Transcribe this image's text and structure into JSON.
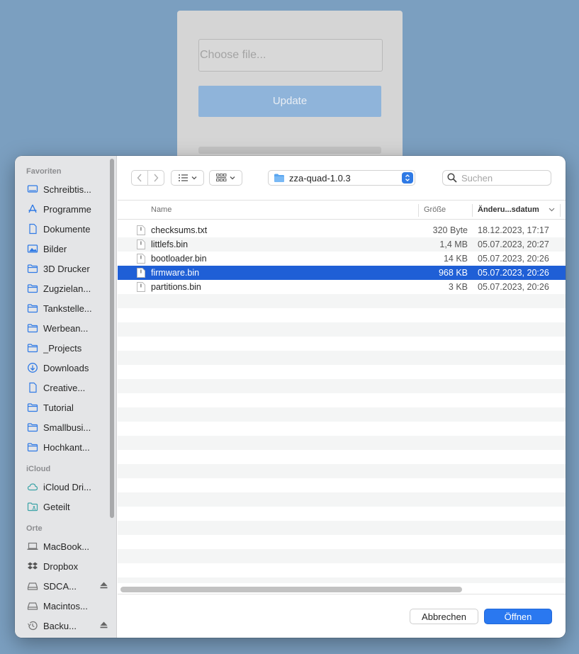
{
  "background_form": {
    "file_placeholder": "Choose file...",
    "update_label": "Update"
  },
  "sidebar": {
    "sections": [
      {
        "title": "Favoriten",
        "items": [
          {
            "label": "Schreibtis...",
            "icon": "desktop-icon"
          },
          {
            "label": "Programme",
            "icon": "applications-icon"
          },
          {
            "label": "Dokumente",
            "icon": "document-icon"
          },
          {
            "label": "Bilder",
            "icon": "pictures-icon"
          },
          {
            "label": "3D Drucker",
            "icon": "folder-icon"
          },
          {
            "label": "Zugzielan...",
            "icon": "folder-icon"
          },
          {
            "label": "Tankstelle...",
            "icon": "folder-icon"
          },
          {
            "label": "Werbean...",
            "icon": "folder-icon"
          },
          {
            "label": "_Projects",
            "icon": "folder-icon"
          },
          {
            "label": "Downloads",
            "icon": "downloads-icon"
          },
          {
            "label": "Creative...",
            "icon": "document-icon"
          },
          {
            "label": "Tutorial",
            "icon": "folder-icon"
          },
          {
            "label": "Smallbusi...",
            "icon": "folder-icon"
          },
          {
            "label": "Hochkant...",
            "icon": "folder-icon"
          }
        ]
      },
      {
        "title": "iCloud",
        "items": [
          {
            "label": "iCloud Dri...",
            "icon": "cloud-icon"
          },
          {
            "label": "Geteilt",
            "icon": "shared-folder-icon"
          }
        ]
      },
      {
        "title": "Orte",
        "items": [
          {
            "label": "MacBook...",
            "icon": "laptop-icon"
          },
          {
            "label": "Dropbox",
            "icon": "dropbox-icon"
          },
          {
            "label": "SDCA...",
            "icon": "drive-icon",
            "eject": true
          },
          {
            "label": "Macintos...",
            "icon": "drive-icon"
          },
          {
            "label": "Backu...",
            "icon": "time-machine-icon",
            "eject": true
          }
        ]
      }
    ]
  },
  "toolbar": {
    "path": "zza-quad-1.0.3",
    "search_placeholder": "Suchen"
  },
  "columns": {
    "name": "Name",
    "size": "Größe",
    "date": "Änderu...sdatum"
  },
  "files": [
    {
      "name": "checksums.txt",
      "size": "320 Byte",
      "date": "18.12.2023, 17:17",
      "selected": false
    },
    {
      "name": "littlefs.bin",
      "size": "1,4 MB",
      "date": "05.07.2023, 20:27",
      "selected": false
    },
    {
      "name": "bootloader.bin",
      "size": "14 KB",
      "date": "05.07.2023, 20:26",
      "selected": false
    },
    {
      "name": "firmware.bin",
      "size": "968 KB",
      "date": "05.07.2023, 20:26",
      "selected": true
    },
    {
      "name": "partitions.bin",
      "size": "3 KB",
      "date": "05.07.2023, 20:26",
      "selected": false
    }
  ],
  "buttons": {
    "cancel": "Abbrechen",
    "open": "Öffnen"
  },
  "colors": {
    "selection": "#1f5fd6",
    "accent": "#2a78f0"
  }
}
